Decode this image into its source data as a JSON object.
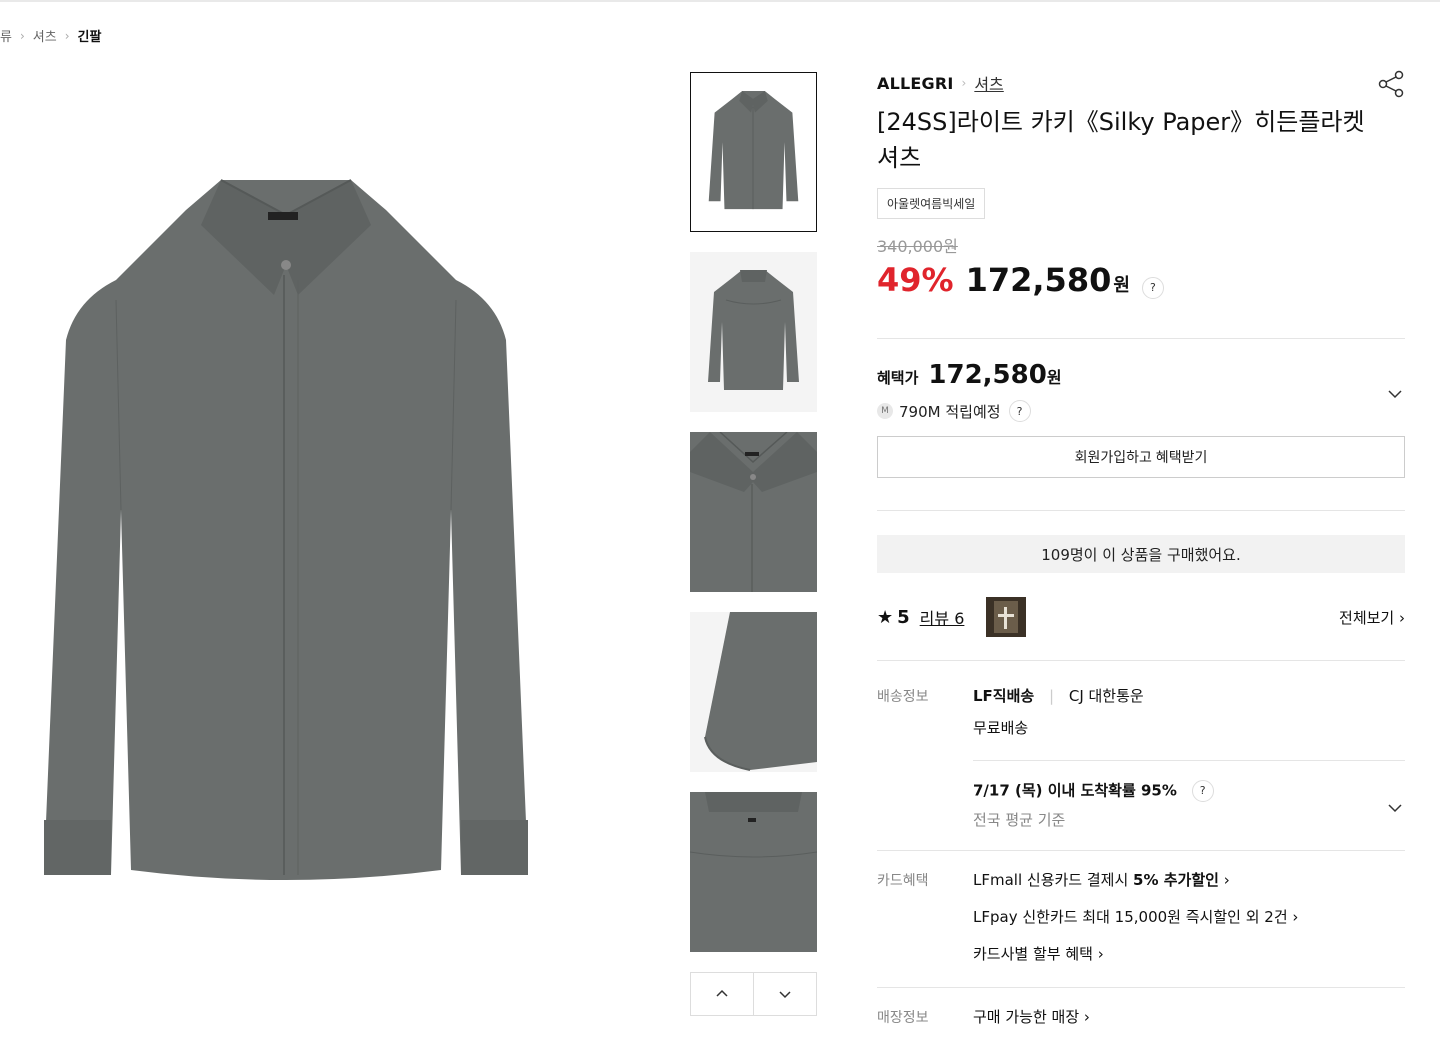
{
  "breadcrumb": [
    "류",
    "셔츠",
    "긴팔"
  ],
  "product": {
    "brand": "ALLEGRI",
    "category": "셔츠",
    "title": "[24SS]라이트 카키《Silky Paper》히든플라켓 셔츠",
    "tag": "아울렛여름빅세일",
    "original_price": "340,000원",
    "discount": "49%",
    "price": "172,580",
    "won": "원",
    "help": "?"
  },
  "benefit": {
    "label": "혜택가",
    "price": "172,580",
    "won": "원",
    "mileage_badge": "M",
    "mileage": "790M 적립예정",
    "join_button": "회원가입하고 혜택받기"
  },
  "bought_text": "109명이 이 상품을 구매했어요.",
  "review": {
    "star": "★",
    "score": "5",
    "link": "리뷰 6",
    "view_all": "전체보기 ›"
  },
  "delivery": {
    "label": "배송정보",
    "method": "LF직배송",
    "carrier": "CJ 대한통운",
    "fee": "무료배송",
    "arrival": "7/17 (목) 이내 도착확률 95%",
    "arrival_note": "전국 평균 기준"
  },
  "card": {
    "label": "카드혜택",
    "line1_prefix": "LFmall 신용카드 결제시 ",
    "line1_bold": "5% 추가할인",
    "line1_arrow": "›",
    "line2": "LFpay 신한카드 최대 15,000원 즉시할인 외 2건 ›",
    "line3": "카드사별 할부 혜택 ›"
  },
  "store": {
    "label": "매장정보",
    "link": "구매 가능한 매장 ›"
  },
  "colors": {
    "shirt": "#6a6e6d",
    "discount": "#e0242c"
  }
}
